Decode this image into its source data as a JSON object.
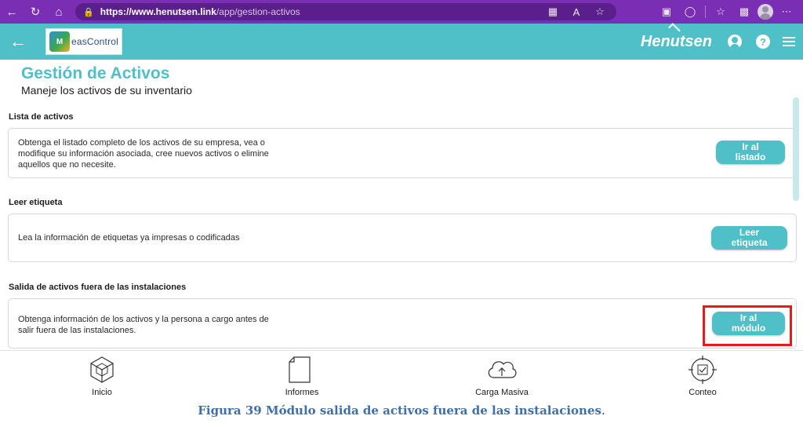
{
  "browser": {
    "url_host": "https://www.henutsen.link",
    "url_path": "/app/gestion-activos",
    "reader_icon_text": "A"
  },
  "app": {
    "logo_text": "easControl",
    "brand": "Henutsen"
  },
  "page": {
    "title": "Gestión de Activos",
    "subtitle": "Maneje los activos de su inventario"
  },
  "sections": [
    {
      "label": "Lista de activos",
      "description": "Obtenga el listado completo de los activos de su empresa, vea o modifique su información asociada, cree nuevos activos o elimine aquellos que no necesite.",
      "button_line1": "Ir al",
      "button_line2": "listado"
    },
    {
      "label": "Leer etiqueta",
      "description": "Lea la información de etiquetas ya impresas o codificadas",
      "button_line1": "Leer",
      "button_line2": "etiqueta"
    },
    {
      "label": "Salida de activos fuera de las instalaciones",
      "description": "Obtenga información de los activos y la persona a cargo antes de salir fuera de las instalaciones.",
      "button_line1": "Ir al",
      "button_line2": "módulo"
    }
  ],
  "bottom_nav": [
    {
      "label": "Inicio",
      "icon": "home-box-icon"
    },
    {
      "label": "Informes",
      "icon": "document-icon"
    },
    {
      "label": "Carga Masiva",
      "icon": "cloud-upload-icon"
    },
    {
      "label": "Conteo",
      "icon": "target-check-icon"
    }
  ],
  "caption": {
    "text": "Figura 39 Módulo salida de activos fuera de las instalaciones",
    "period": "."
  },
  "colors": {
    "browser_purple": "#7a2eb4",
    "accent_teal": "#4fbfc8",
    "highlight_red": "#e31b1b",
    "caption_blue": "#3e6fa8"
  }
}
